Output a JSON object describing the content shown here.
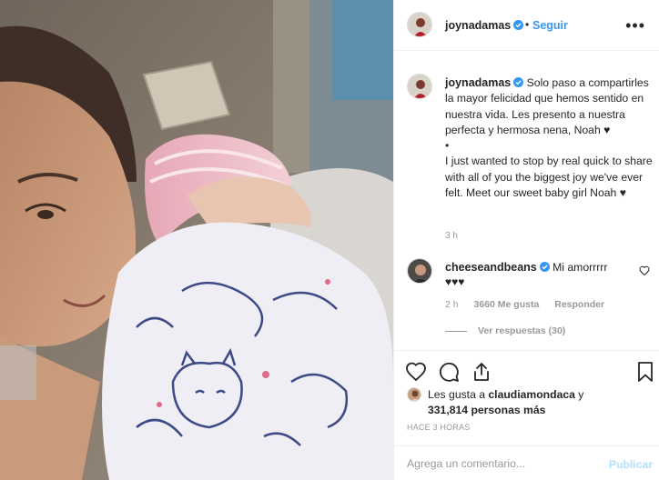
{
  "post": {
    "photo_alt": "",
    "author": {
      "username": "joynadamas",
      "verified": true,
      "follow_label": "Seguir",
      "separator": "•"
    },
    "more_label": "•••",
    "caption": {
      "username": "joynadamas",
      "text": "Solo paso a compartirles la mayor felicidad que hemos sentido en nuestra vida. Les presento a nuestra perfecta y hermosa nena, Noah ♥\n•\nI just wanted to stop by real quick to share with all of you the biggest joy we've ever felt. Meet our sweet baby girl Noah ♥",
      "time": "3 h"
    },
    "comments": [
      {
        "username": "cheeseandbeans",
        "verified": true,
        "text": "Mi amorrrrr",
        "hearts": "♥♥♥",
        "time": "2 h",
        "likes": "3660 Me gusta",
        "reply_label": "Responder",
        "view_replies": "Ver respuestas (30)"
      }
    ],
    "actions": [
      "heart-icon",
      "comment-icon",
      "share-icon",
      "bookmark-icon"
    ],
    "likes": {
      "prefix": "Les gusta a ",
      "user": "claudiamondaca",
      "middle": " y",
      "count": "331,814 personas más"
    },
    "posted_ago": "HACE 3 HORAS",
    "comment_input": {
      "placeholder": "Agrega un comentario...",
      "value": ""
    },
    "publish_label": "Publicar",
    "colors": {
      "link_blue": "#3897f0",
      "publish_disabled": "#b2dffc",
      "muted": "#999999"
    }
  }
}
